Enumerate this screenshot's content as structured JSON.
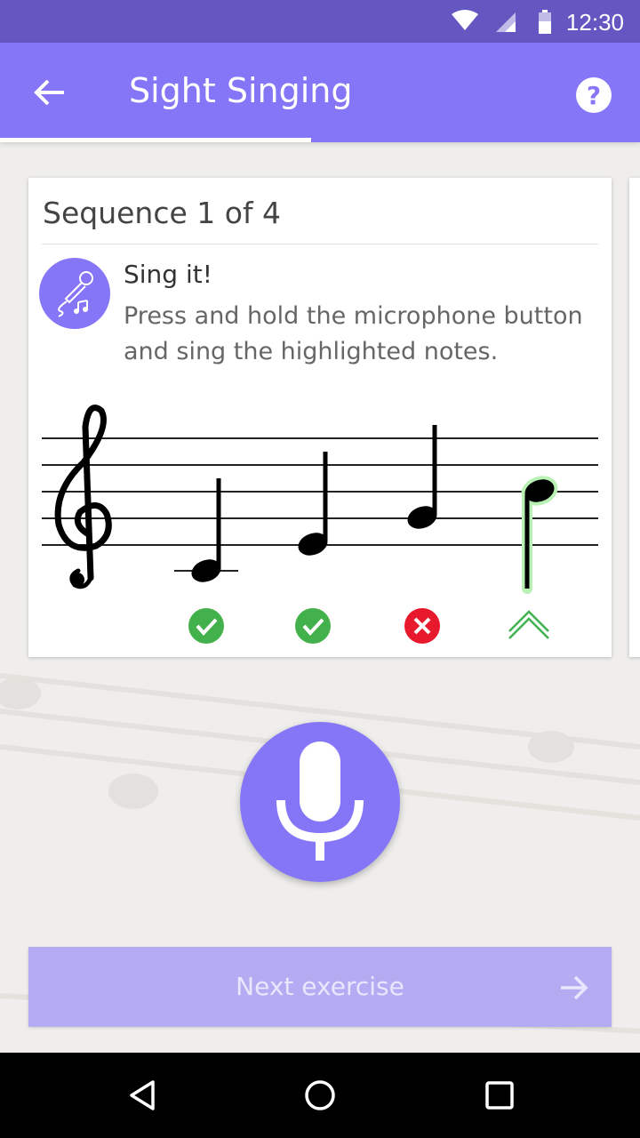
{
  "status_bar": {
    "time": "12:30"
  },
  "app_bar": {
    "title": "Sight Singing",
    "progress_fraction": 0.486
  },
  "card": {
    "sequence_label": "Sequence 1 of 4",
    "instruction_title": "Sing it!",
    "instruction_text": "Press and hold the microphone button and sing the highlighted notes.",
    "notes": [
      {
        "pitch": "C4",
        "result": "correct"
      },
      {
        "pitch": "E4",
        "result": "correct"
      },
      {
        "pitch": "G4",
        "result": "incorrect"
      },
      {
        "pitch": "B4",
        "result": "sing-higher"
      }
    ]
  },
  "next_button": {
    "label": "Next exercise"
  },
  "colors": {
    "accent": "#8575f7",
    "status_bar": "#6557c2",
    "correct": "#43b14b",
    "incorrect": "#e8192c"
  },
  "icons": [
    "wifi-icon",
    "cell-signal-icon",
    "battery-icon",
    "back-arrow-icon",
    "help-icon",
    "microphone-note-icon",
    "treble-clef-icon",
    "check-icon",
    "error-icon",
    "chevron-up-icon",
    "microphone-icon",
    "arrow-right-icon",
    "nav-back-icon",
    "nav-home-icon",
    "nav-recents-icon"
  ]
}
